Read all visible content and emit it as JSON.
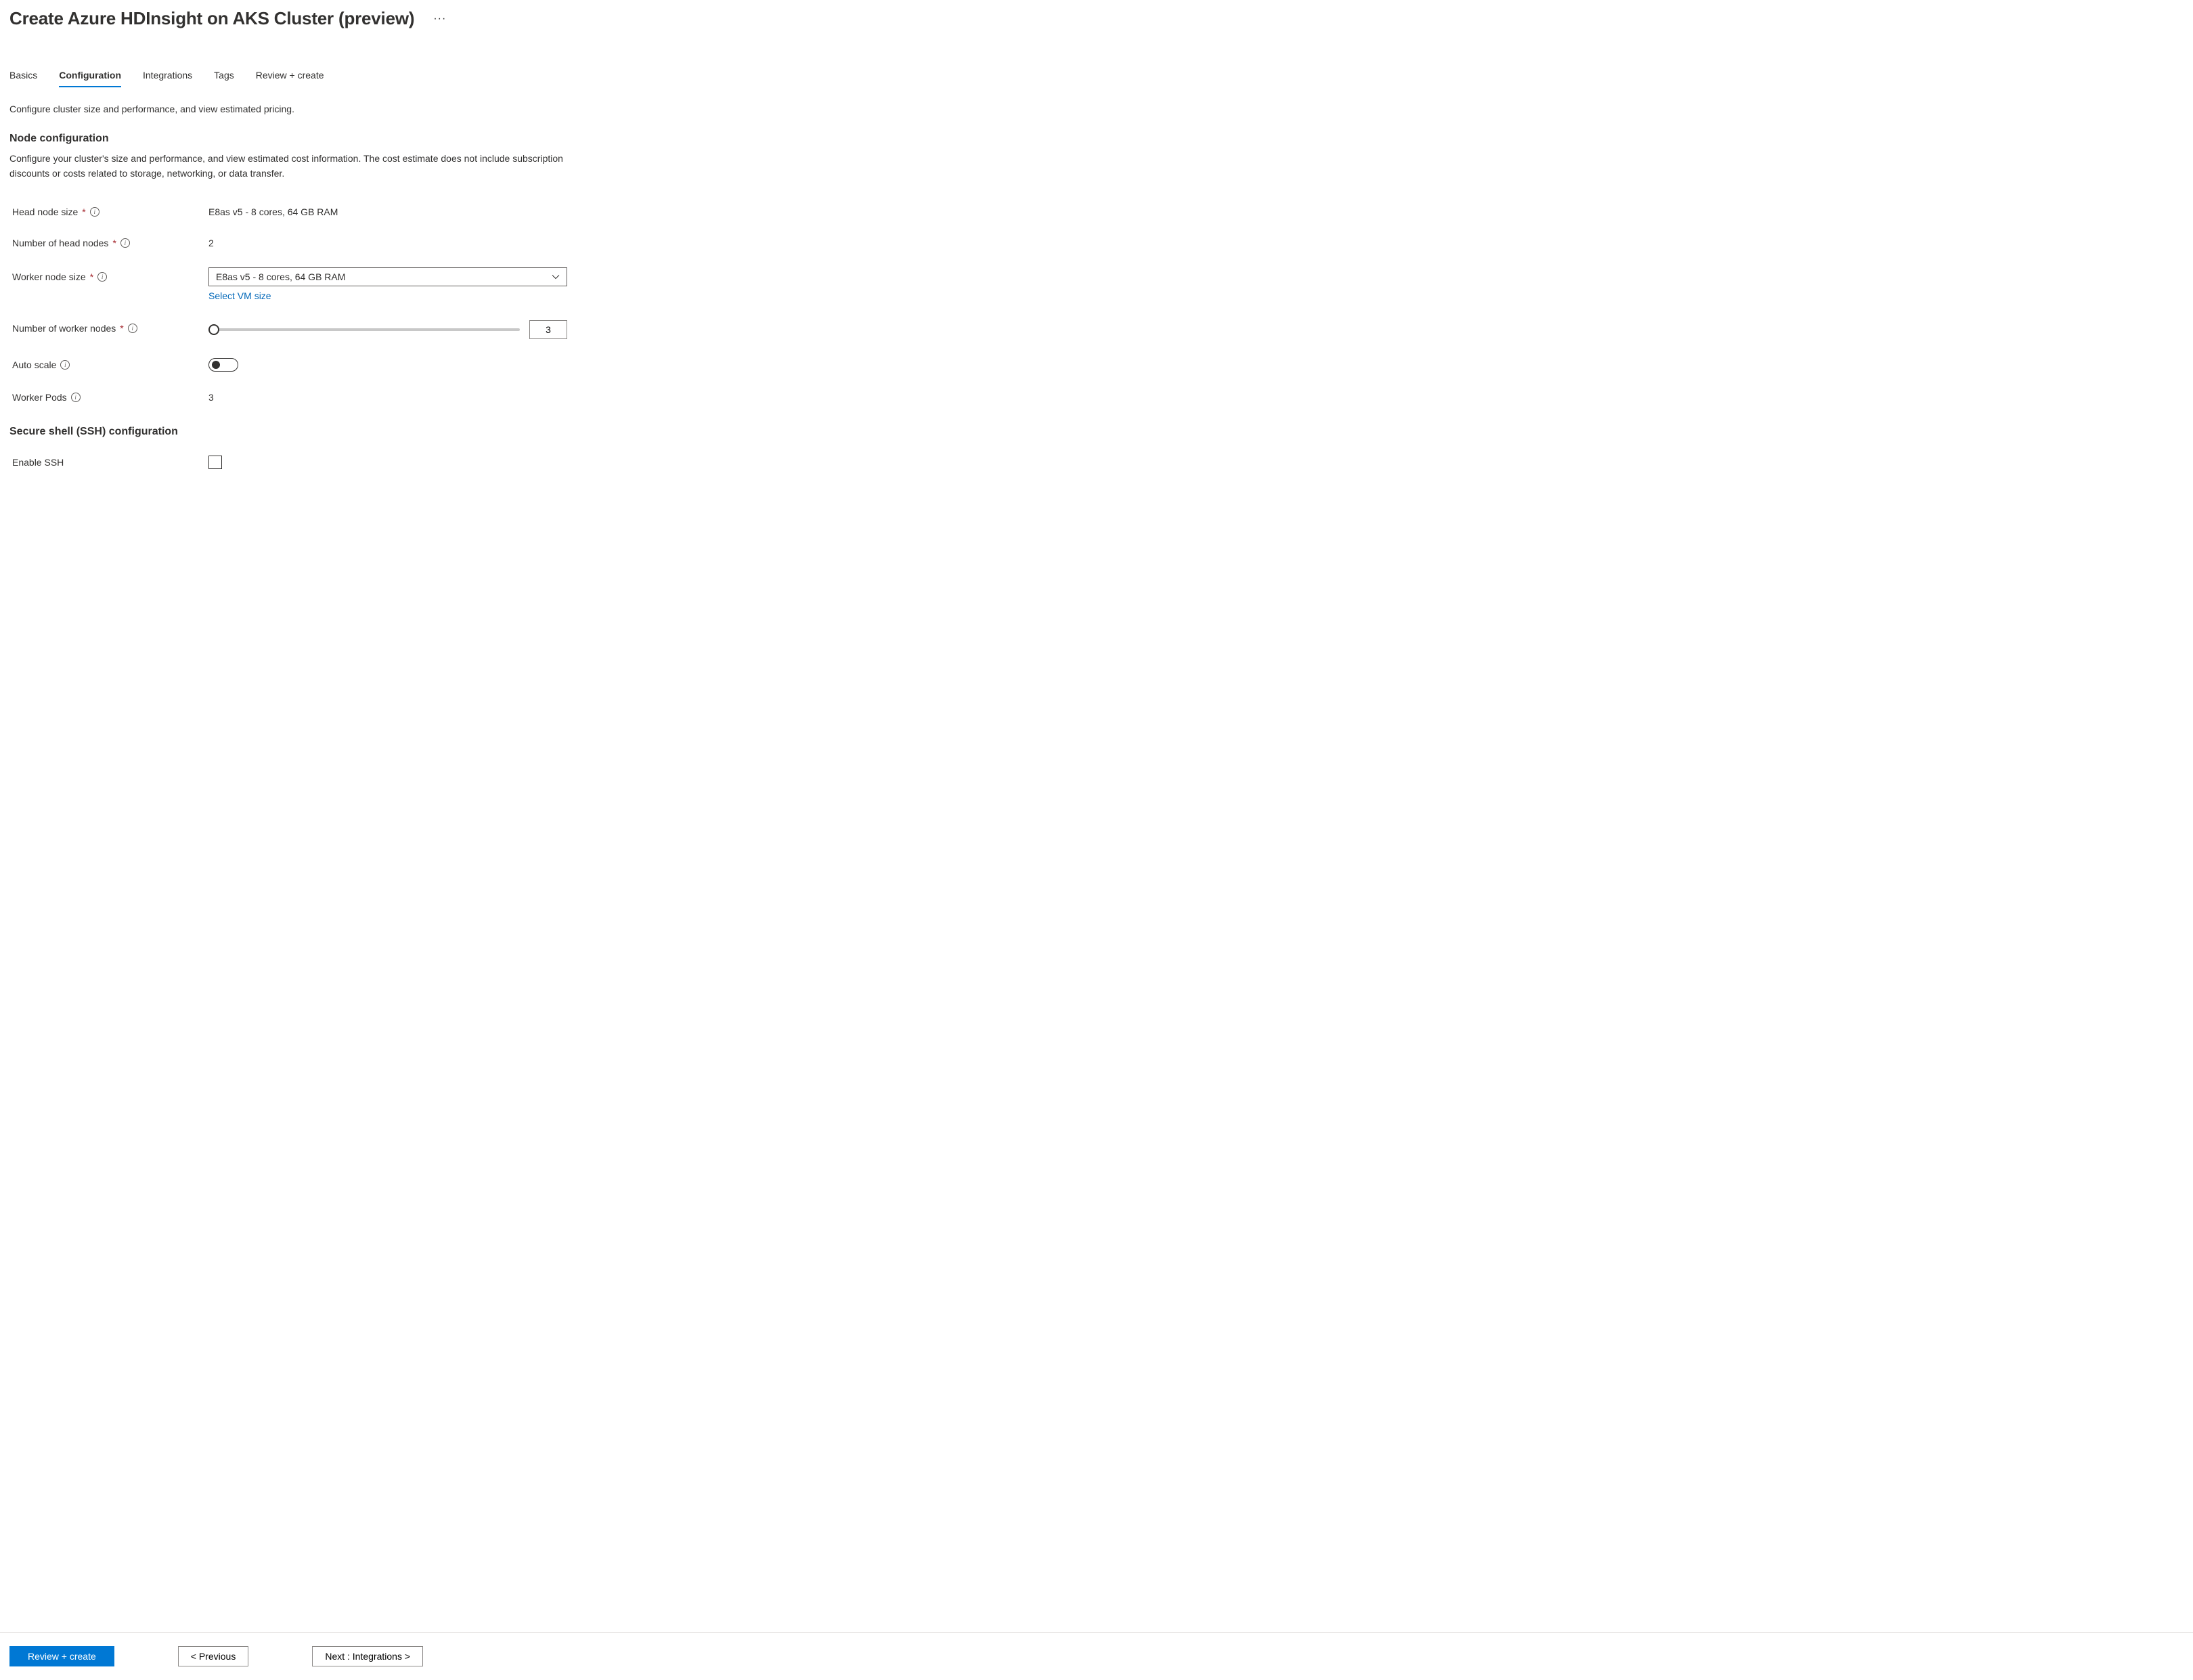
{
  "header": {
    "title": "Create Azure HDInsight on AKS Cluster (preview)"
  },
  "tabs": [
    {
      "label": "Basics"
    },
    {
      "label": "Configuration"
    },
    {
      "label": "Integrations"
    },
    {
      "label": "Tags"
    },
    {
      "label": "Review + create"
    }
  ],
  "active_tab_index": 1,
  "intro": "Configure cluster size and performance, and view estimated pricing.",
  "node_config": {
    "heading": "Node configuration",
    "description": "Configure your cluster's size and performance, and view estimated cost information. The cost estimate does not include subscription discounts or costs related to storage, networking, or data transfer.",
    "head_node_size": {
      "label": "Head node size",
      "value": "E8as v5 - 8 cores, 64 GB RAM",
      "required": true
    },
    "num_head_nodes": {
      "label": "Number of head nodes",
      "value": "2",
      "required": true
    },
    "worker_node_size": {
      "label": "Worker node size",
      "selected": "E8as v5 - 8 cores, 64 GB RAM",
      "link": "Select VM size",
      "required": true
    },
    "num_worker_nodes": {
      "label": "Number of worker nodes",
      "value": "3",
      "required": true
    },
    "auto_scale": {
      "label": "Auto scale",
      "enabled": false
    },
    "worker_pods": {
      "label": "Worker Pods",
      "value": "3"
    }
  },
  "ssh": {
    "heading": "Secure shell (SSH) configuration",
    "enable_label": "Enable SSH",
    "enabled": false
  },
  "footer": {
    "review": "Review + create",
    "previous": "< Previous",
    "next": "Next : Integrations >"
  }
}
